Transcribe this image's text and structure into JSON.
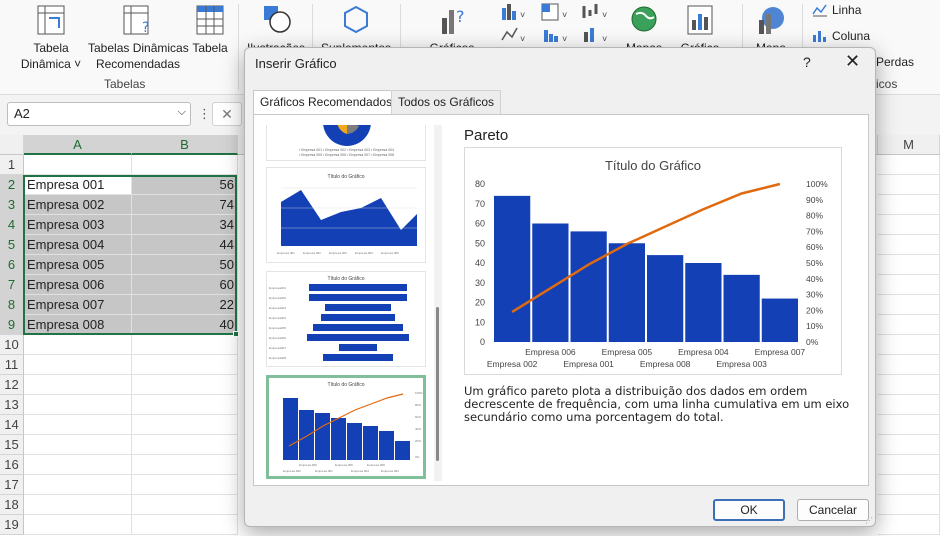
{
  "ribbon": {
    "buttons": [
      {
        "id": "pivot",
        "label": "Tabela\nDinâmica ˅"
      },
      {
        "id": "rec_pivot",
        "label": "Tabelas Dinâmicas\nRecomendadas"
      },
      {
        "id": "table",
        "label": "Tabela"
      },
      {
        "id": "illustrations",
        "label": "Ilustrações"
      },
      {
        "id": "addins",
        "label": "Suplementos"
      },
      {
        "id": "charts",
        "label": "Gráficos"
      },
      {
        "id": "maps",
        "label": "Mapas"
      },
      {
        "id": "pivotchart",
        "label": "Gráfico"
      },
      {
        "id": "map3d",
        "label": "Mapa"
      }
    ],
    "group_tables": "Tabelas",
    "sparkline_line": "Linha",
    "sparkline_column": "Coluna",
    "sparkline_winloss": "Perdas",
    "group_sparklines_partial": "icos"
  },
  "formula_bar": {
    "name_box": "A2",
    "dots": "⋮",
    "cancel": "✕"
  },
  "sheet": {
    "columns": [
      "A",
      "B",
      "M"
    ],
    "rows": [
      "1",
      "2",
      "3",
      "4",
      "5",
      "6",
      "7",
      "8",
      "9",
      "10",
      "11",
      "12",
      "13",
      "14",
      "15",
      "16",
      "17",
      "18",
      "19"
    ],
    "data": [
      {
        "a": "Empresa 001",
        "b": "56"
      },
      {
        "a": "Empresa 002",
        "b": "74"
      },
      {
        "a": "Empresa 003",
        "b": "34"
      },
      {
        "a": "Empresa 004",
        "b": "44"
      },
      {
        "a": "Empresa 005",
        "b": "50"
      },
      {
        "a": "Empresa 006",
        "b": "60"
      },
      {
        "a": "Empresa 007",
        "b": "22"
      },
      {
        "a": "Empresa 008",
        "b": "40"
      }
    ]
  },
  "dialog": {
    "title": "Inserir Gráfico",
    "help": "?",
    "close": "✕",
    "tabs": [
      "Gráficos Recomendados",
      "Todos os Gráficos"
    ],
    "ok": "OK",
    "cancel": "Cancelar",
    "preview": {
      "name": "Pareto",
      "description": "Um gráfico pareto plota a distribuição dos dados em ordem decrescente de frequência, com uma linha cumulativa em um eixo secundário como uma porcentagem do total."
    },
    "thumb_title": "Título do Gráfico"
  },
  "colors": {
    "bar": "#1340b5",
    "line": "#e06a10",
    "accent": "#217346"
  },
  "chart_data": {
    "type": "bar",
    "title": "Título do Gráfico",
    "categories": [
      "Empresa 002",
      "Empresa 006",
      "Empresa 001",
      "Empresa 005",
      "Empresa 008",
      "Empresa 004",
      "Empresa 003",
      "Empresa 007"
    ],
    "values": [
      74,
      60,
      56,
      50,
      44,
      40,
      34,
      22
    ],
    "cumulative_percent": [
      19,
      34,
      49,
      62,
      73,
      84,
      94,
      100
    ],
    "ylim": [
      0,
      80
    ],
    "yticks": [
      "0",
      "10",
      "20",
      "30",
      "40",
      "50",
      "60",
      "70",
      "80"
    ],
    "y2lim": [
      0,
      100
    ],
    "y2ticks": [
      "0%",
      "10%",
      "20%",
      "30%",
      "40%",
      "50%",
      "60%",
      "70%",
      "80%",
      "90%",
      "100%"
    ],
    "grid": false
  }
}
